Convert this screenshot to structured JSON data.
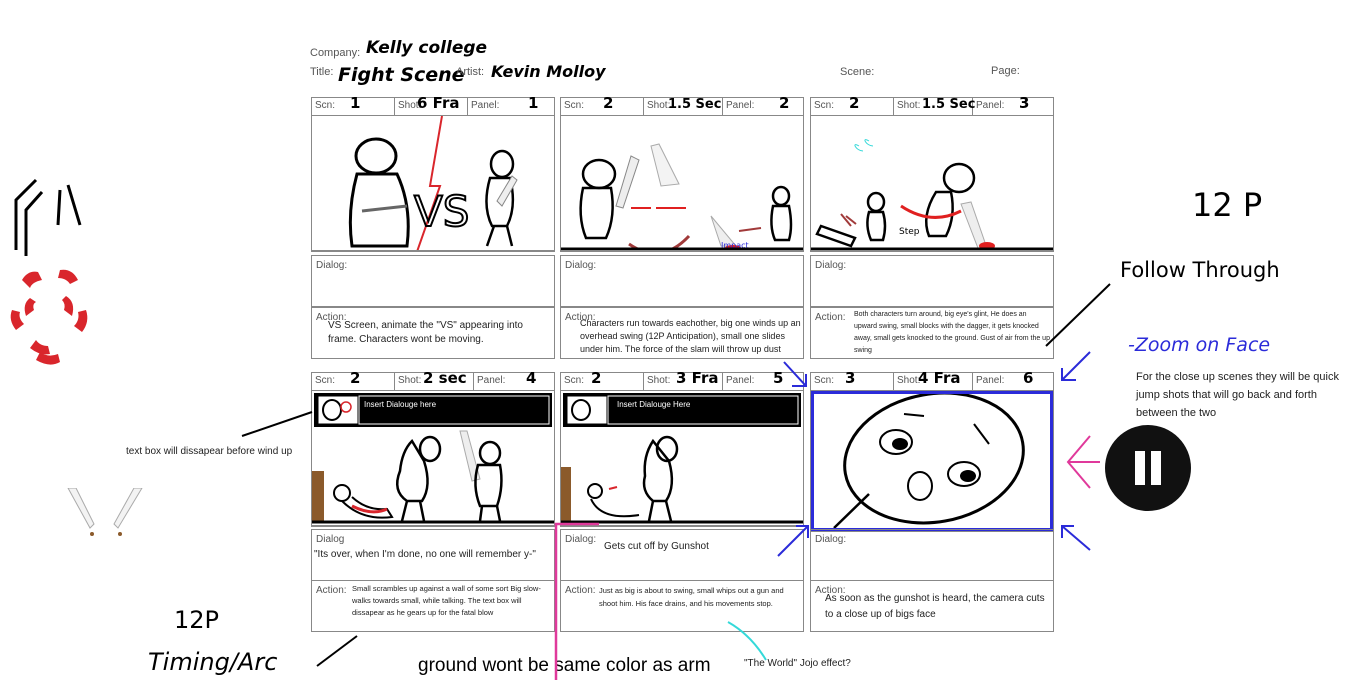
{
  "header": {
    "company_label": "Company:",
    "company_value": "Kelly college",
    "title_label": "Title:",
    "title_value": "Fight Scene",
    "artist_label": "Artist:",
    "artist_value": "Kevin Molloy",
    "scene_label": "Scene:",
    "page_label": "Page:"
  },
  "labels": {
    "scn": "Scn:",
    "shot": "Shot:",
    "panel": "Panel:",
    "dialog1": "Dialog:",
    "dialog2": "Dialog:",
    "dialog3": "Dialog:",
    "dialog4": "Dialog",
    "dialog5": "Dialog:",
    "dialog6": "Dialog:",
    "action": "Action:"
  },
  "panels": [
    {
      "scn": "1",
      "shot": "6 Fra",
      "panel": "1",
      "dialog": "",
      "action": "VS Screen, animate the \"VS\" appearing into frame. Characters wont be moving."
    },
    {
      "scn": "2",
      "shot": "1.5 Sec",
      "panel": "2",
      "dialog": "",
      "action": "Characters run towards eachother, big one winds up an overhead swing (12P Anticipation), small one slides under him. The force of the slam will throw up dust"
    },
    {
      "scn": "2",
      "shot": "1.5 Sec",
      "panel": "3",
      "dialog": "",
      "action": "Both characters turn around, big eye's glint, He does an upward swing, small blocks with the dagger, it gets knocked away, small gets knocked to the ground. Gust of air from the up swing"
    },
    {
      "scn": "2",
      "shot": "2 sec",
      "panel": "4",
      "dialog": "\"Its over, when I'm done, no one will remember y-\"",
      "action": "Small scrambles up against a wall of some sort Big slow-walks towards small, while talking. The text box will dissapear as he gears up for the fatal blow"
    },
    {
      "scn": "2",
      "shot": "3 Fra",
      "panel": "5",
      "dialog": "Gets cut off by Gunshot",
      "action": "Just as big is about to swing, small whips out a gun and shoot him. His face drains, and his movements stop."
    },
    {
      "scn": "3",
      "shot": "4 Fra",
      "panel": "6",
      "dialog": "",
      "action": "As soon as the gunshot is heard, the camera cuts to a close up of bigs face"
    }
  ],
  "panel_text": {
    "vs": "VS",
    "impact": "Impact",
    "step": "Step",
    "insert1": "Insert Dialouge here",
    "insert2": "Insert Dialouge Here"
  },
  "annotations": {
    "twelve_p_top": "12 P",
    "follow_through": "Follow Through",
    "zoom_on_face": "-Zoom on Face",
    "close_up_note": "For the close up scenes they will be quick jump shots that will go back and forth between the two",
    "text_box_note": "text box will dissapear before wind up",
    "twelve_p_bottom": "12P",
    "timing_arc": "Timing/Arc",
    "ground_note": "ground wont be same color as arm",
    "the_world_note": "\"The World\" Jojo effect?"
  },
  "colors": {
    "red": "#d9262c",
    "blue": "#2b2bd9",
    "magenta": "#e0399b",
    "cyan": "#35d9d9",
    "arrow_red": "#e02020",
    "dark_red": "#a13a3a"
  }
}
